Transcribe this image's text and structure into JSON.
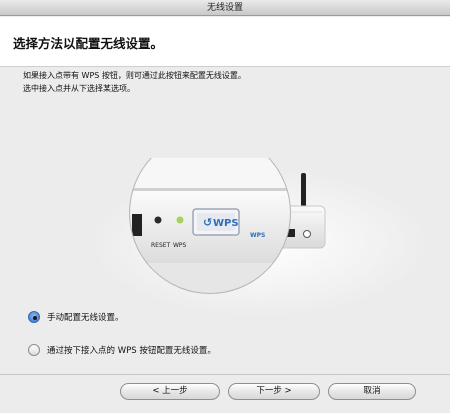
{
  "window": {
    "title": "无线设置"
  },
  "header": {
    "title": "选择方法以配置无线设置。"
  },
  "description": {
    "line1": "如果接入点带有 WPS 按钮，则可通过此按钮来配置无线设置。",
    "line2": "选中接入点并从下选择某选项。"
  },
  "illustration": {
    "reset_label": "RESET",
    "wps_label": "WPS",
    "wps_button_label": "WPS"
  },
  "options": [
    {
      "label": "手动配置无线设置。",
      "selected": true
    },
    {
      "label": "通过按下接入点的 WPS 按钮配置无线设置。",
      "selected": false
    }
  ],
  "footer": {
    "back_label": "< 上一步",
    "next_label": "下一步 >",
    "cancel_label": "取消"
  }
}
